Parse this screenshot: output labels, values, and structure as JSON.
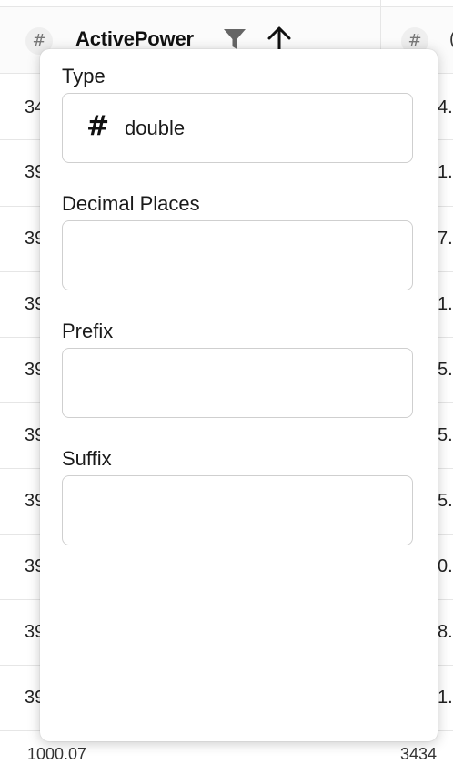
{
  "table": {
    "column_icon": "#",
    "column_title": "ActivePower",
    "next_column_icon": "#",
    "next_column_partial": "(",
    "left_cells": [
      "34",
      "39",
      "39",
      "39",
      "39",
      "39",
      "39",
      "39",
      "39",
      "39"
    ],
    "right_cells": [
      "4.",
      "1.",
      "7.",
      "1.",
      "5.",
      "5.",
      "5.",
      "0.",
      "8.",
      "1."
    ],
    "bottom_left": "1000.07",
    "bottom_right": "3434"
  },
  "popover": {
    "type_label": "Type",
    "type_icon": "#",
    "type_value": "double",
    "decimal_label": "Decimal Places",
    "decimal_value": "",
    "prefix_label": "Prefix",
    "prefix_value": "",
    "suffix_label": "Suffix",
    "suffix_value": ""
  },
  "icons": {
    "filter": "filter-icon",
    "sort": "arrow-up-icon"
  }
}
